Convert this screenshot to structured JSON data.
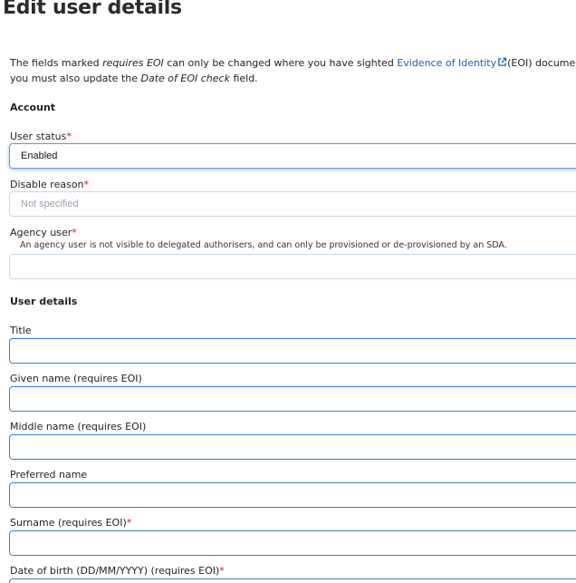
{
  "page": {
    "title": "Edit user details"
  },
  "intro": {
    "text_before": "The fields marked ",
    "requires_eoi": "requires EOI",
    "text_mid": " can only be changed where you have sighted ",
    "link_label": "Evidence of Identity",
    "text_after": "(EOI) documentation in accordan",
    "line2_before": "you must also update the ",
    "line2_em": "Date of EOI check",
    "line2_after": " field."
  },
  "account": {
    "heading": "Account",
    "user_status": {
      "label": "User status",
      "value": "Enabled"
    },
    "disable_reason": {
      "label": "Disable reason",
      "placeholder": "Not specified"
    },
    "agency_user": {
      "label": "Agency user",
      "hint": "An agency user is not visible to delegated authorisers, and can only be provisioned or de-provisioned by an SDA.",
      "value": ""
    }
  },
  "user_details": {
    "heading": "User details",
    "fields": [
      {
        "label": "Title",
        "required": false,
        "value": ""
      },
      {
        "label": "Given name (requires EOI)",
        "required": false,
        "value": ""
      },
      {
        "label": "Middle name (requires EOI)",
        "required": false,
        "value": ""
      },
      {
        "label": "Preferred name",
        "required": false,
        "value": ""
      },
      {
        "label": "Surname (requires EOI)",
        "required": true,
        "value": ""
      },
      {
        "label": "Date of birth (DD/MM/YYYY) (requires EOI)",
        "required": true,
        "value": ""
      }
    ]
  },
  "required_marker": "*",
  "colors": {
    "link": "#1a5fb4",
    "required": "#c0242a",
    "field_border_blue": "#3d7ec6"
  }
}
